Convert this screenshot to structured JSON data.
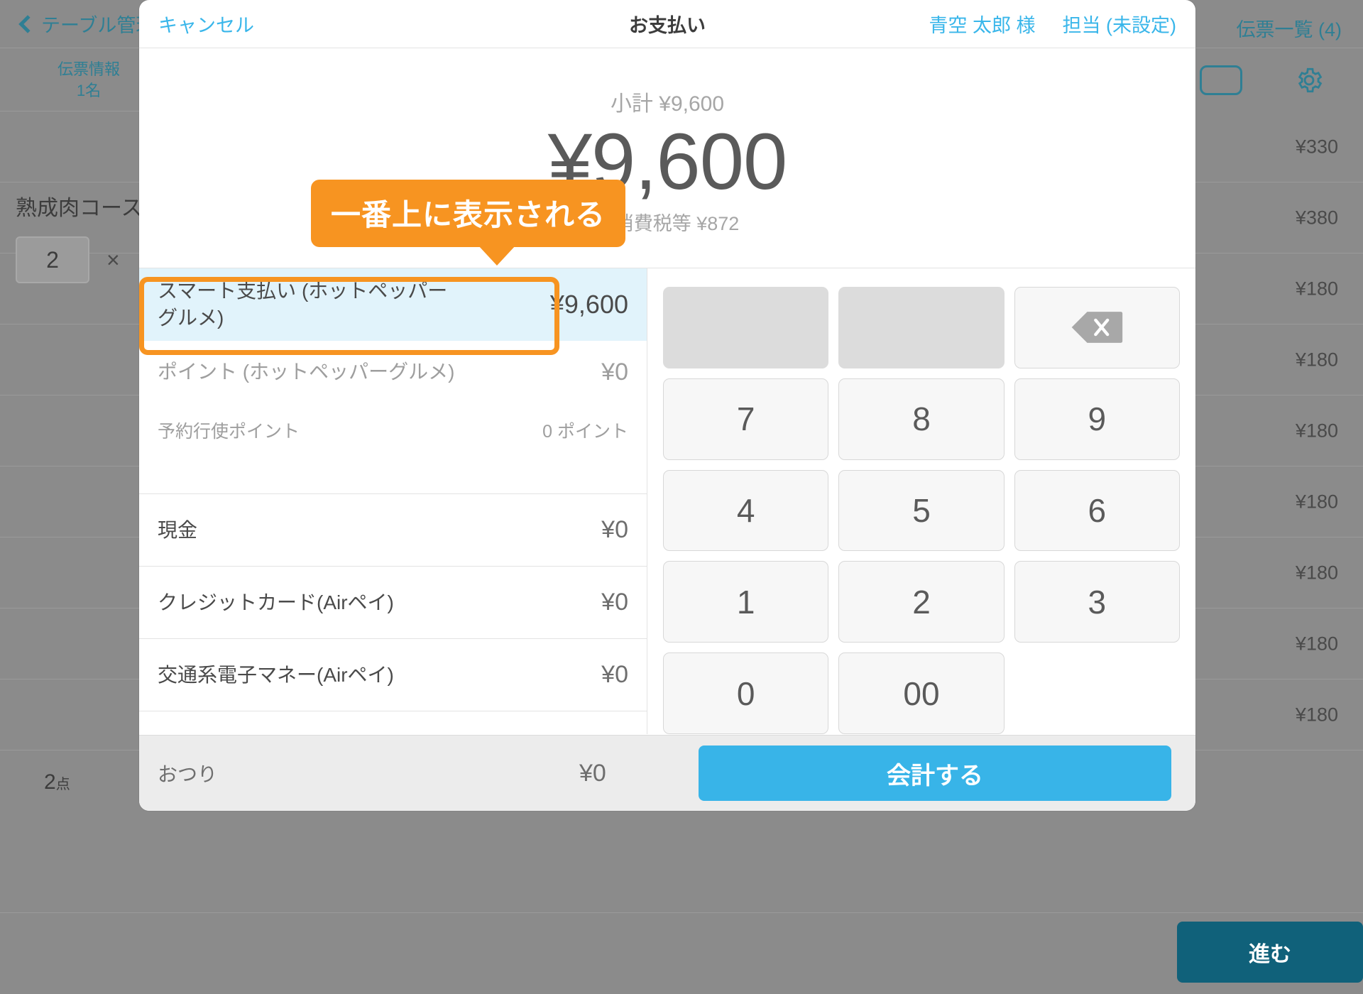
{
  "background": {
    "nav": {
      "back_label": "テーブル管理",
      "receipts_label": "伝票一覧 (4)",
      "paren": ")"
    },
    "info": {
      "title": "伝票情報",
      "guests": "1名"
    },
    "course_name": "熟成肉コース",
    "quantity": "2",
    "times_symbol": "×",
    "prices": [
      "¥330",
      "¥380",
      "¥180",
      "¥180",
      "¥180",
      "¥180",
      "¥180",
      "¥180",
      "¥180"
    ],
    "footer": {
      "item_count": "2",
      "item_unit": "点",
      "next_label": "進む"
    }
  },
  "modal": {
    "header": {
      "cancel_label": "キャンセル",
      "title": "お支払い",
      "customer": "青空 太郎 様",
      "staff": "担当 (未設定)"
    },
    "totals": {
      "subtotal_label": "小計",
      "subtotal_value": "¥9,600",
      "grand_total": "¥9,600",
      "tax_label": "内消費税等",
      "tax_value": "¥872"
    },
    "callout": {
      "text": "一番上に表示される",
      "color": "#f79421"
    },
    "payment_methods": [
      {
        "label": "スマート支払い (ホットペッパーグルメ)",
        "amount": "¥9,600",
        "selected": true,
        "muted": false
      },
      {
        "label": "ポイント (ホットペッパーグルメ)",
        "amount": "¥0",
        "selected": false,
        "muted": true
      },
      {
        "label": "現金",
        "amount": "¥0",
        "selected": false,
        "muted": false
      },
      {
        "label": "クレジットカード(Airペイ)",
        "amount": "¥0",
        "selected": false,
        "muted": false
      },
      {
        "label": "交通系電子マネー(Airペイ)",
        "amount": "¥0",
        "selected": false,
        "muted": false
      }
    ],
    "sub_row": {
      "label": "予約行使ポイント",
      "value": "0 ポイント"
    },
    "keypad": {
      "blank1": "",
      "blank2": "",
      "backspace_icon": "backspace-icon",
      "keys": [
        "7",
        "8",
        "9",
        "4",
        "5",
        "6",
        "1",
        "2",
        "3",
        "0",
        "00"
      ]
    },
    "footer": {
      "change_label": "おつり",
      "change_amount": "¥0",
      "pay_label": "会計する",
      "pay_color": "#38b4e8"
    }
  }
}
